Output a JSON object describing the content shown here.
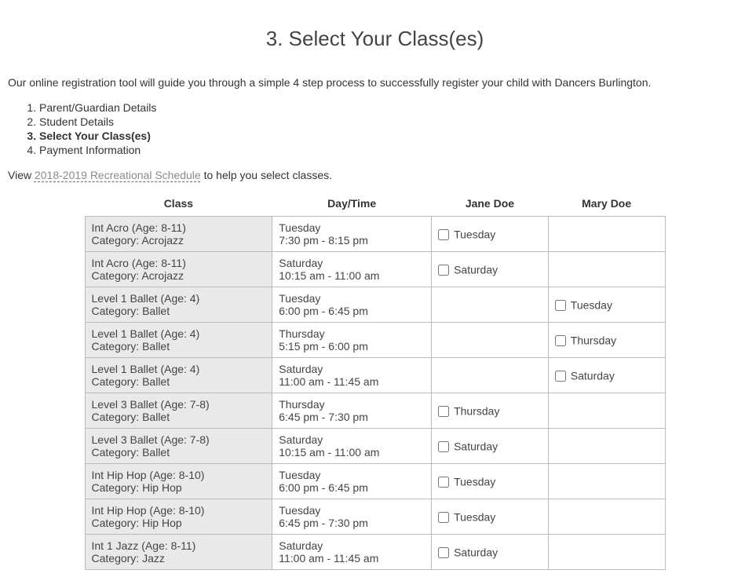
{
  "page_title": "3. Select Your Class(es)",
  "intro": "Our online registration tool will guide you through a simple 4 step process to successfully register your child with Dancers Burlington.",
  "steps": [
    "Parent/Guardian Details",
    "Student Details",
    "Select Your Class(es)",
    "Payment Information"
  ],
  "active_step_index": 2,
  "schedule_prefix": "View ",
  "schedule_link_text": "2018-2019 Recreational Schedule",
  "schedule_suffix": " to help you select classes.",
  "table": {
    "headers": {
      "class": "Class",
      "daytime": "Day/Time",
      "students": [
        "Jane Doe",
        "Mary Doe"
      ]
    },
    "rows": [
      {
        "class_name": "Int Acro (Age: 8-11)",
        "category": "Category: Acrojazz",
        "day": "Tuesday",
        "time": "7:30 pm - 8:15 pm",
        "student1_day": "Tuesday",
        "student2_day": null
      },
      {
        "class_name": "Int Acro (Age: 8-11)",
        "category": "Category: Acrojazz",
        "day": "Saturday",
        "time": "10:15 am - 11:00 am",
        "student1_day": "Saturday",
        "student2_day": null
      },
      {
        "class_name": "Level 1 Ballet (Age: 4)",
        "category": "Category: Ballet",
        "day": "Tuesday",
        "time": "6:00 pm - 6:45 pm",
        "student1_day": null,
        "student2_day": "Tuesday"
      },
      {
        "class_name": "Level 1 Ballet (Age: 4)",
        "category": "Category: Ballet",
        "day": "Thursday",
        "time": "5:15 pm - 6:00 pm",
        "student1_day": null,
        "student2_day": "Thursday"
      },
      {
        "class_name": "Level 1 Ballet (Age: 4)",
        "category": "Category: Ballet",
        "day": "Saturday",
        "time": "11:00 am - 11:45 am",
        "student1_day": null,
        "student2_day": "Saturday"
      },
      {
        "class_name": "Level 3 Ballet (Age: 7-8)",
        "category": "Category: Ballet",
        "day": "Thursday",
        "time": "6:45 pm - 7:30 pm",
        "student1_day": "Thursday",
        "student2_day": null
      },
      {
        "class_name": "Level 3 Ballet (Age: 7-8)",
        "category": "Category: Ballet",
        "day": "Saturday",
        "time": "10:15 am - 11:00 am",
        "student1_day": "Saturday",
        "student2_day": null
      },
      {
        "class_name": "Int Hip Hop (Age: 8-10)",
        "category": "Category: Hip Hop",
        "day": "Tuesday",
        "time": "6:00 pm - 6:45 pm",
        "student1_day": "Tuesday",
        "student2_day": null
      },
      {
        "class_name": "Int Hip Hop (Age: 8-10)",
        "category": "Category: Hip Hop",
        "day": "Tuesday",
        "time": "6:45 pm - 7:30 pm",
        "student1_day": "Tuesday",
        "student2_day": null
      },
      {
        "class_name": "Int 1 Jazz (Age: 8-11)",
        "category": "Category: Jazz",
        "day": "Saturday",
        "time": "11:00 am - 11:45 am",
        "student1_day": "Saturday",
        "student2_day": null
      }
    ]
  }
}
